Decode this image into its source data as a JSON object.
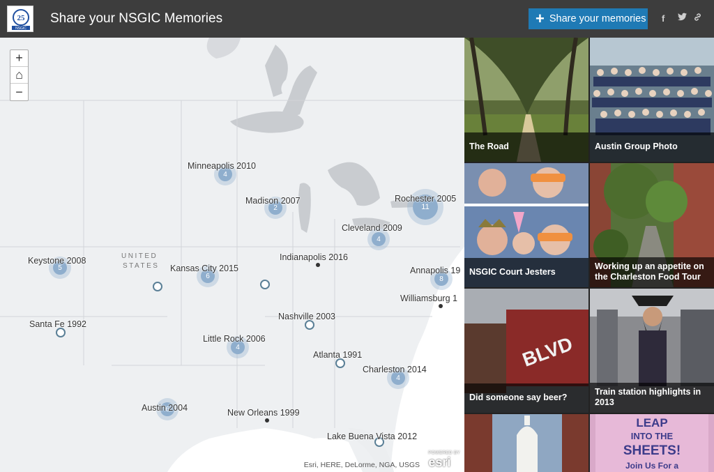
{
  "header": {
    "logo_text": "25",
    "logo_sub": "NSGIC",
    "title": "Share your NSGIC Memories",
    "share_button": "Share your memories",
    "social": {
      "facebook": "f",
      "twitter": "t",
      "link": "link"
    }
  },
  "map": {
    "zoom_in": "+",
    "home": "⌂",
    "zoom_out": "−",
    "country_label": [
      "UNITED",
      "STATES"
    ],
    "cities": {
      "minneapolis": "Minneapolis 2010",
      "madison": "Madison 2007",
      "rochester": "Rochester 2005",
      "cleveland": "Cleveland 2009",
      "indianapolis": "Indianapolis 2016",
      "keystone": "Keystone 2008",
      "kansas_city": "Kansas City 2015",
      "annapolis": "Annapolis 19",
      "williamsburg": "Williamsburg 1",
      "santa_fe": "Santa Fe 1992",
      "nashville": "Nashville 2003",
      "little_rock": "Little Rock 2006",
      "atlanta": "Atlanta 1991",
      "charleston": "Charleston 2014",
      "austin": "Austin 2004",
      "new_orleans": "New Orleans 1999",
      "lake_buena_vista": "Lake Buena Vista 2012"
    },
    "clusters": {
      "minneapolis": "4",
      "madison": "2",
      "rochester": "11",
      "cleveland": "4",
      "keystone": "5",
      "kansas_city": "6",
      "annapolis": "8",
      "little_rock": "4",
      "charleston": "4",
      "austin": "6"
    },
    "attribution": "Esri, HERE, DeLorme, NGA, USGS",
    "esri_powered": "POWERED BY",
    "esri_logo": "esri"
  },
  "gallery": [
    {
      "caption": "The Road"
    },
    {
      "caption": "Austin Group Photo"
    },
    {
      "caption": "NSGIC Court Jesters"
    },
    {
      "caption": "Working up an appetite on the Charleston Food Tour"
    },
    {
      "caption": "Did someone say beer?"
    },
    {
      "caption": "Train station highlights in 2013"
    },
    {
      "caption": ""
    },
    {
      "caption": ""
    }
  ],
  "colors": {
    "header_bg": "#3d3d3d",
    "button_blue": "#1f7ab5",
    "cluster": "#8faecd",
    "marker_ring": "#5a7f96"
  }
}
